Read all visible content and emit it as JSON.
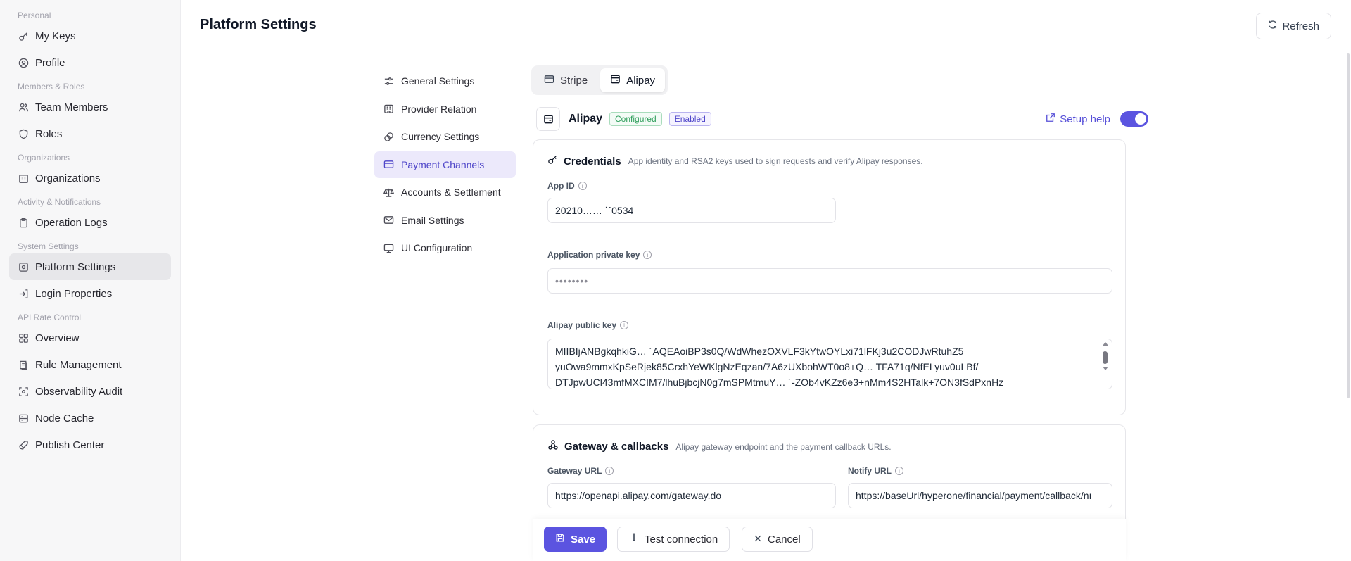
{
  "sidebar": {
    "groups": [
      {
        "label": "Personal"
      },
      {
        "label": "Members & Roles"
      },
      {
        "label": "Organizations"
      },
      {
        "label": "Activity & Notifications"
      },
      {
        "label": "System Settings"
      },
      {
        "label": "API Rate Control"
      }
    ],
    "items": [
      {
        "label": "My Keys",
        "icon": "key-icon"
      },
      {
        "label": "Profile",
        "icon": "user-circle-icon"
      },
      {
        "label": "Team Members",
        "icon": "users-icon"
      },
      {
        "label": "Roles",
        "icon": "shield-icon"
      },
      {
        "label": "Organizations",
        "icon": "building-icon"
      },
      {
        "label": "Operation Logs",
        "icon": "clipboard-icon"
      },
      {
        "label": "Platform Settings",
        "icon": "settings-box-icon",
        "active": true
      },
      {
        "label": "Login Properties",
        "icon": "login-arrow-icon"
      },
      {
        "label": "Overview",
        "icon": "grid-icon"
      },
      {
        "label": "Rule Management",
        "icon": "book-icon"
      },
      {
        "label": "Observability Audit",
        "icon": "scan-icon"
      },
      {
        "label": "Node Cache",
        "icon": "database-icon"
      },
      {
        "label": "Publish Center",
        "icon": "rocket-icon"
      }
    ]
  },
  "header": {
    "title": "Platform Settings",
    "refresh_label": "Refresh"
  },
  "settings_nav": {
    "items": [
      {
        "label": "General Settings",
        "icon": "sliders-icon"
      },
      {
        "label": "Provider Relation",
        "icon": "building-icon"
      },
      {
        "label": "Currency Settings",
        "icon": "coins-icon"
      },
      {
        "label": "Payment Channels",
        "icon": "credit-card-icon",
        "active": true
      },
      {
        "label": "Accounts & Settlement",
        "icon": "scale-icon"
      },
      {
        "label": "Email Settings",
        "icon": "mail-icon"
      },
      {
        "label": "UI Configuration",
        "icon": "monitor-icon"
      }
    ]
  },
  "tabs": [
    {
      "label": "Stripe",
      "icon": "card-icon"
    },
    {
      "label": "Alipay",
      "icon": "wallet-icon",
      "active": true
    }
  ],
  "channel": {
    "name": "Alipay",
    "badge_configured": "Configured",
    "badge_enabled": "Enabled",
    "setup_help": "Setup help",
    "enabled": true
  },
  "credentials": {
    "title": "Credentials",
    "description": "App identity and RSA2 keys used to sign requests and verify Alipay responses.",
    "app_id_label": "App ID",
    "app_id_value": "20210…… ˙´0534",
    "private_key_label": "Application private key",
    "private_key_value": "••••••••",
    "public_key_label": "Alipay public key",
    "public_key_lines": [
      "MIIBIjANBgkqhkiG…                              ´AQEAoiBP3s0Q/WdWhezOXVLF3kYtwOYLxi71lFKj3u2CODJwRtuhZ5",
      "yuOwa9mmxKpSeRjek85CrxhYeWKlgNzEqzan/7A6zUXbohWT0o8+Q…                           TFA71q/NfELyuv0uLBf/",
      "DTJpwUCl43mfMXCIM7/lhuBjbcjN0g7mSPMtmuY…                            ´‑ZOb4vKZz6e3+nMm4S2HTalk+7ON3fSdPxnHz"
    ]
  },
  "gateway": {
    "title": "Gateway & callbacks",
    "description": "Alipay gateway endpoint and the payment callback URLs.",
    "gateway_url_label": "Gateway URL",
    "gateway_url_value": "https://openapi.alipay.com/gateway.do",
    "notify_url_label": "Notify URL",
    "notify_url_value": "https://baseUrl/hyperone/financial/payment/callback/nı"
  },
  "footer": {
    "save_label": "Save",
    "test_label": "Test connection",
    "cancel_label": "Cancel"
  },
  "colors": {
    "accent": "#5b54e0",
    "active_nav_bg": "#ece9fb",
    "configured_green": "#2f9e5b",
    "sidebar_bg": "#f7f7f8"
  }
}
